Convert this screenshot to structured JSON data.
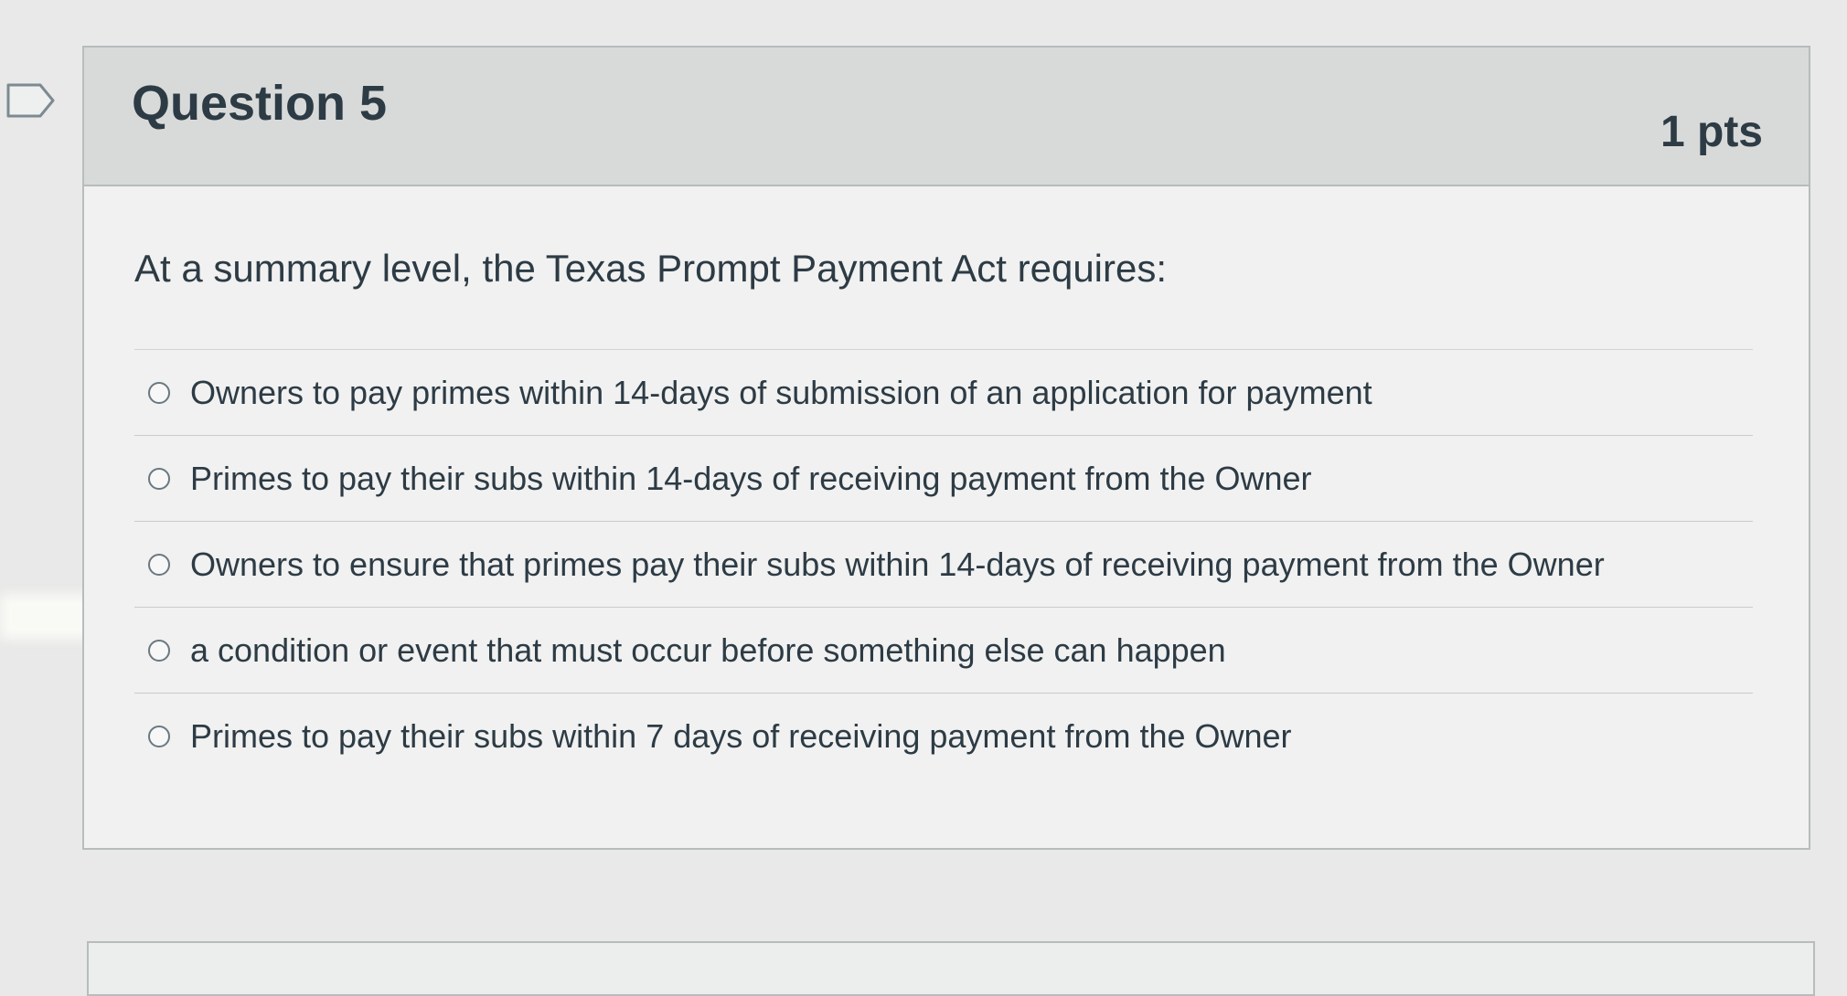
{
  "question": {
    "title": "Question 5",
    "points": "1 pts",
    "text": "At a summary level, the Texas Prompt Payment Act requires:",
    "answers": [
      {
        "label": "Owners to pay primes within 14-days of submission of an application for payment",
        "selected": false
      },
      {
        "label": "Primes to pay their subs within 14-days of receiving payment from the Owner",
        "selected": false
      },
      {
        "label": "Owners to ensure that primes pay their subs within 14-days of receiving payment from the Owner",
        "selected": false
      },
      {
        "label": "a condition or event that must occur before something else can happen",
        "selected": false
      },
      {
        "label": "Primes to pay their subs within 7 days of receiving payment from the Owner",
        "selected": false
      }
    ]
  },
  "icons": {
    "flag": "flag-question-icon",
    "radio": "radio-button-icon"
  },
  "colors": {
    "header_bg": "#d8dad9",
    "card_bg": "#f0f1f0",
    "text": "#2d3b45",
    "border": "#b8bcbd"
  }
}
